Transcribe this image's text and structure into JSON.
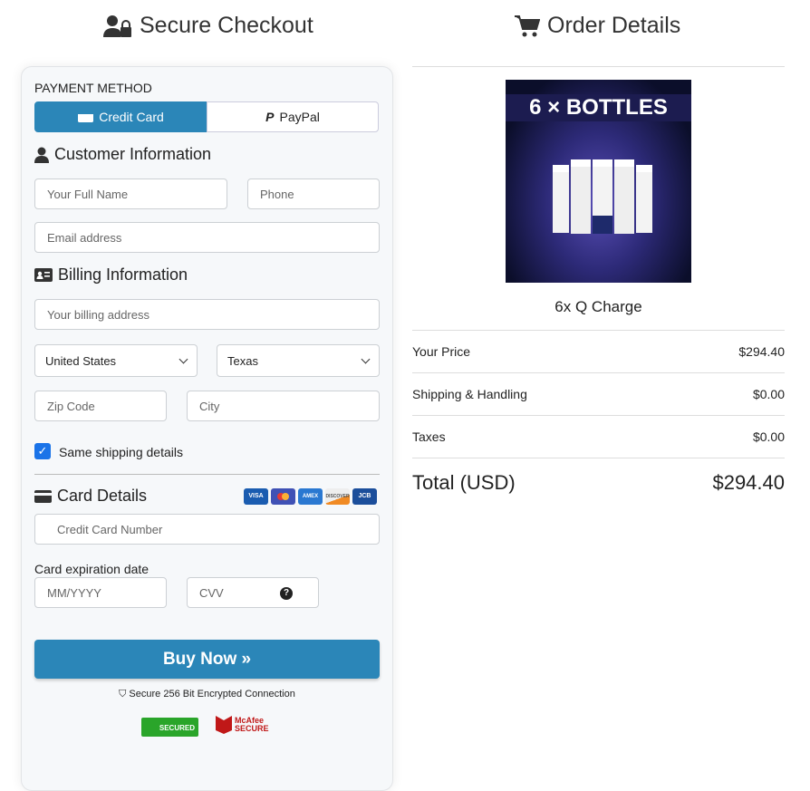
{
  "left": {
    "title": "Secure Checkout",
    "payment_method_label": "PAYMENT METHOD",
    "tabs": [
      {
        "label": "Credit Card",
        "active": true
      },
      {
        "label": "PayPal",
        "active": false
      }
    ],
    "customer_heading": "Customer Information",
    "full_name_placeholder": "Your Full Name",
    "phone_placeholder": "Phone",
    "email_placeholder": "Email address",
    "billing_heading": "Billing Information",
    "billing_address_placeholder": "Your billing address",
    "country": "United States",
    "state": "Texas",
    "zip_placeholder": "Zip Code",
    "city_placeholder": "City",
    "same_shipping_label": "Same shipping details",
    "same_shipping_checked": true,
    "card_heading": "Card Details",
    "card_brands": [
      "VISA",
      "MC",
      "AMEX",
      "DISCOVER",
      "JCB"
    ],
    "card_number_placeholder": "Credit Card Number",
    "expiration_label": "Card expiration date",
    "expiry_placeholder": "MM/YYYY",
    "cvv_placeholder": "CVV",
    "buy_button": "Buy Now »",
    "secure_text": "Secure 256 Bit Encrypted Connection",
    "badges": [
      "SECURED",
      "McAfee SECURE"
    ],
    "accent": "#2b86b8"
  },
  "right": {
    "title": "Order Details",
    "image_text": "6 × BOTTLES",
    "product_name": "6x Q Charge",
    "rows": [
      {
        "label": "Your Price",
        "value": "$294.40"
      },
      {
        "label": "Shipping & Handling",
        "value": "$0.00"
      },
      {
        "label": "Taxes",
        "value": "$0.00"
      }
    ],
    "total_label": "Total (USD)",
    "total_value": "$294.40"
  }
}
